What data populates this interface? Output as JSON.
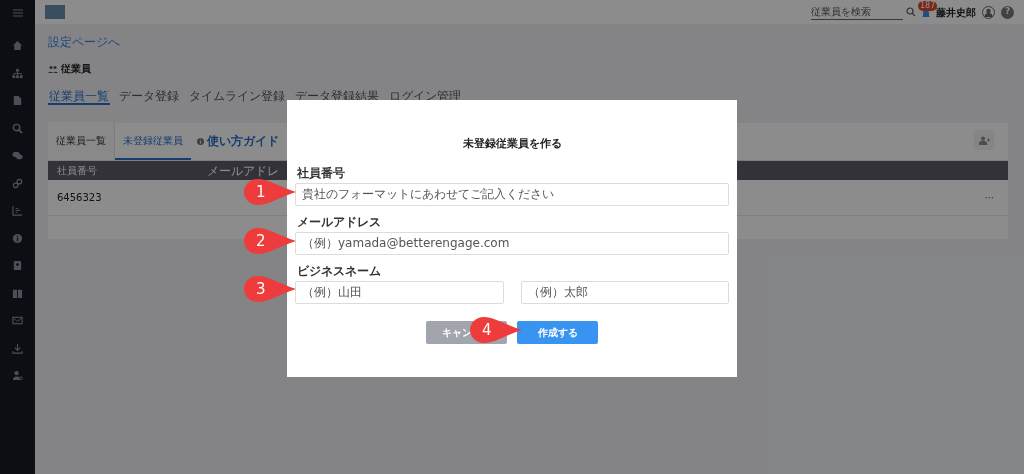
{
  "header": {
    "search": {
      "placeholder": "従業員を検索"
    },
    "notification_badge": "187",
    "user_name": "藤井史郎",
    "help": "?"
  },
  "back_link": "設定ページへ",
  "page_title": "従業員",
  "tabs": [
    {
      "label": "従業員一覧",
      "selected": true
    },
    {
      "label": "データ登録",
      "selected": false
    },
    {
      "label": "タイムライン登録",
      "selected": false
    },
    {
      "label": "データ登録結果",
      "selected": false
    },
    {
      "label": "ログイン管理",
      "selected": false
    }
  ],
  "subtabs": [
    {
      "label": "従業員一覧",
      "selected": false
    },
    {
      "label": "未登録従業員",
      "selected": true
    }
  ],
  "guide_link": "使い方ガイド",
  "table": {
    "columns": [
      "社員番号",
      "メールアドレ"
    ],
    "rows": [
      {
        "cells": [
          "6456323"
        ],
        "menu": "···"
      }
    ]
  },
  "modal": {
    "title": "未登録従業員を作る",
    "fields": [
      {
        "label": "社員番号",
        "inputs": [
          {
            "placeholder": "貴社のフォーマットにあわせてご記入ください"
          }
        ]
      },
      {
        "label": "メールアドレス",
        "inputs": [
          {
            "placeholder": "（例）yamada@betterengage.com"
          }
        ]
      },
      {
        "label": "ビジネスネーム",
        "inputs": [
          {
            "placeholder": "（例）山田"
          },
          {
            "placeholder": "（例）太郎"
          }
        ]
      }
    ],
    "buttons": [
      {
        "label": "キャン",
        "kind": "cancel"
      },
      {
        "label": "作成する",
        "kind": "primary"
      }
    ]
  },
  "step_markers": [
    "1",
    "2",
    "3",
    "4"
  ]
}
